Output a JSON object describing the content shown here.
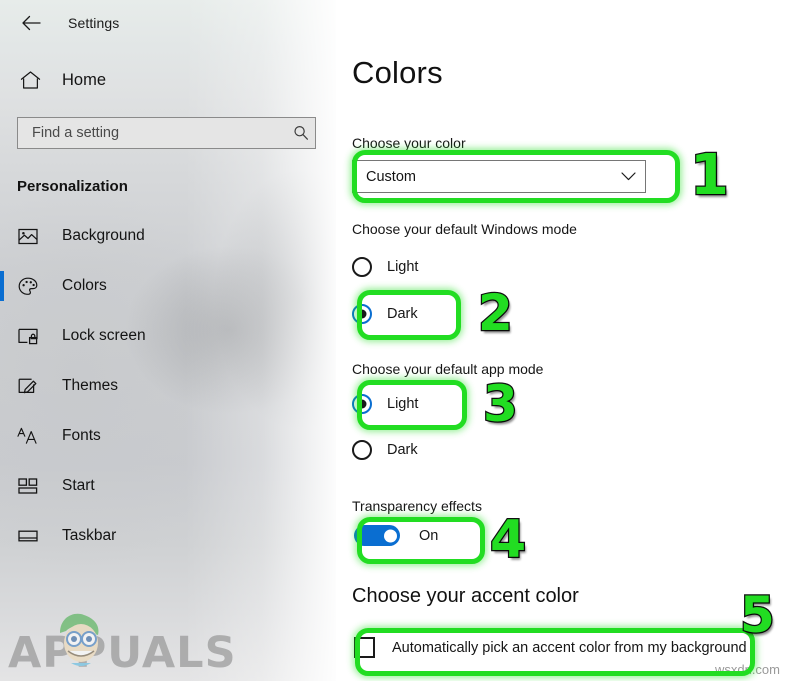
{
  "window": {
    "title": "Settings",
    "back_icon": "back-arrow-icon"
  },
  "sidebar": {
    "home": {
      "label": "Home",
      "icon": "home-icon"
    },
    "search": {
      "placeholder": "Find a setting",
      "icon": "search-icon",
      "value": ""
    },
    "category": "Personalization",
    "items": [
      {
        "label": "Background",
        "icon": "image-icon",
        "selected": false
      },
      {
        "label": "Colors",
        "icon": "palette-icon",
        "selected": true
      },
      {
        "label": "Lock screen",
        "icon": "lock-screen-icon",
        "selected": false
      },
      {
        "label": "Themes",
        "icon": "themes-brush-icon",
        "selected": false
      },
      {
        "label": "Fonts",
        "icon": "fonts-aa-icon",
        "selected": false
      },
      {
        "label": "Start",
        "icon": "start-tiles-icon",
        "selected": false
      },
      {
        "label": "Taskbar",
        "icon": "taskbar-icon",
        "selected": false
      }
    ],
    "watermark": "APPUALS"
  },
  "main": {
    "page_title": "Colors",
    "choose_color": {
      "label": "Choose your color",
      "selected": "Custom",
      "chevron_icon": "chevron-down-icon"
    },
    "windows_mode": {
      "label": "Choose your default Windows mode",
      "options": [
        {
          "label": "Light",
          "checked": false
        },
        {
          "label": "Dark",
          "checked": true
        }
      ]
    },
    "app_mode": {
      "label": "Choose your default app mode",
      "options": [
        {
          "label": "Light",
          "checked": true
        },
        {
          "label": "Dark",
          "checked": false
        }
      ]
    },
    "transparency": {
      "label": "Transparency effects",
      "state": "On",
      "on": true
    },
    "accent": {
      "heading": "Choose your accent color",
      "auto_pick_label": "Automatically pick an accent color from my background",
      "auto_pick_checked": false
    }
  },
  "annotations": {
    "color": "#22dd22",
    "markers": [
      {
        "number": "1",
        "target": "choose-your-color-dropdown"
      },
      {
        "number": "2",
        "target": "windows-mode-dark-radio"
      },
      {
        "number": "3",
        "target": "app-mode-light-radio"
      },
      {
        "number": "4",
        "target": "transparency-effects-toggle"
      },
      {
        "number": "5",
        "target": "auto-pick-accent-checkbox"
      }
    ]
  },
  "site_watermark": "wsxdn.com"
}
